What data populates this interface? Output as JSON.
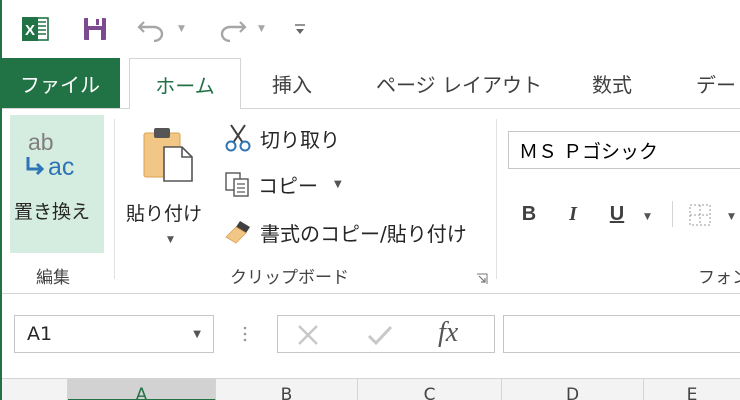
{
  "qat": {
    "app_icon": "excel-logo-icon",
    "app_letter": "X",
    "save_icon": "save-icon",
    "undo_icon": "undo-icon",
    "redo_icon": "redo-icon",
    "customize_icon": "customize-qat-icon"
  },
  "tabs": [
    {
      "label": "ファイル"
    },
    {
      "label": "ホーム"
    },
    {
      "label": "挿入"
    },
    {
      "label": "ページ レイアウト"
    },
    {
      "label": "数式"
    },
    {
      "label": "デー"
    }
  ],
  "ribbon": {
    "editing": {
      "replace_icon_top": "ab",
      "replace_icon_bottom": "ac",
      "replace_label": "置き換え",
      "group_label": "編集"
    },
    "clipboard": {
      "paste_label": "貼り付け",
      "cut_label": "切り取り",
      "copy_label": "コピー",
      "format_painter_label": "書式のコピー/貼り付け",
      "group_label": "クリップボード"
    },
    "font": {
      "font_name": "ＭＳ Ｐゴシック",
      "bold": "B",
      "italic": "I",
      "underline": "U",
      "group_label": "フォン"
    }
  },
  "formula_bar": {
    "name_box": "A1",
    "fx_label": "fx"
  },
  "columns": [
    "A",
    "B",
    "C",
    "D",
    "E"
  ],
  "colors": {
    "excel_green": "#217346",
    "selected_fill": "#d5ece0",
    "save_purple": "#7b4a91"
  }
}
